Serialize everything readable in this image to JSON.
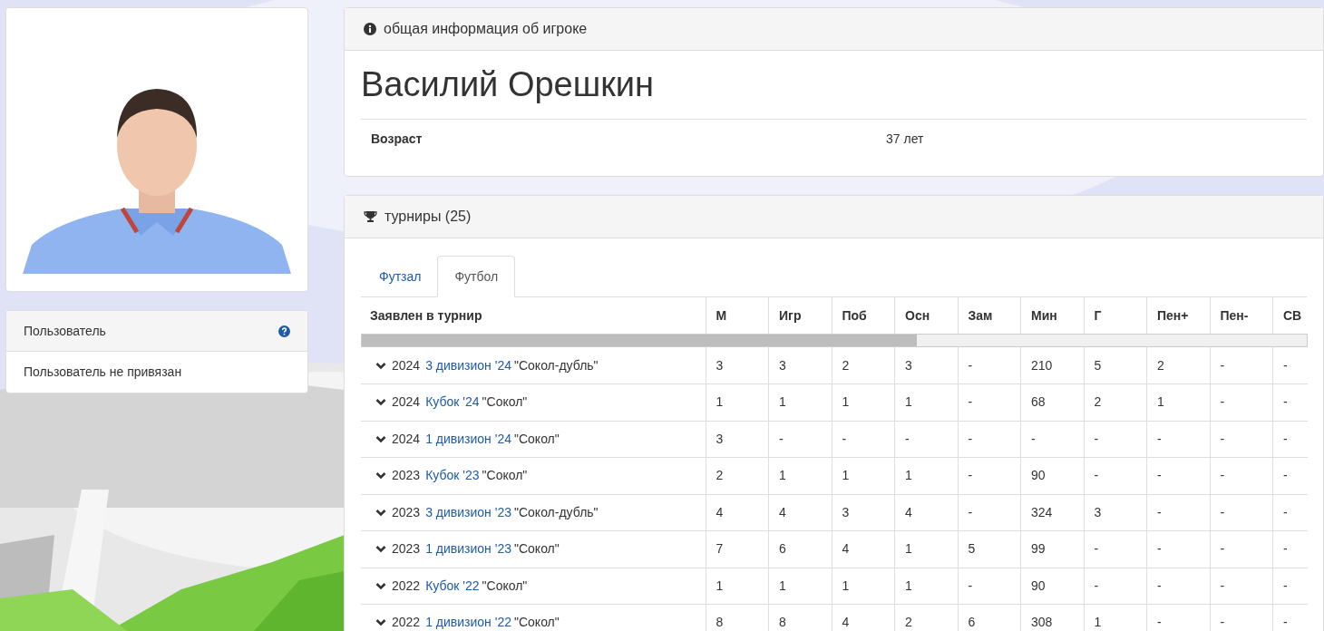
{
  "sidebar": {
    "user_list": [
      {
        "label": "Пользователь",
        "help": true
      },
      {
        "label": "Пользователь не привязан",
        "help": false
      }
    ]
  },
  "info_panel": {
    "title": "общая информация об игроке",
    "name": "Василий Орешкин",
    "fields": [
      {
        "label": "Возраст",
        "value": "37 лет"
      }
    ]
  },
  "tournaments_panel": {
    "title": "турниры (25)",
    "tabs": [
      {
        "label": "Футзал",
        "selected": false
      },
      {
        "label": "Футбол",
        "selected": true
      }
    ],
    "table": {
      "columns": [
        "Заявлен в турнир",
        "М",
        "Игр",
        "Поб",
        "Осн",
        "Зам",
        "Мин",
        "Г",
        "Пен+",
        "Пен-",
        "СВ"
      ],
      "rows": [
        {
          "year": "2024",
          "tournament": "3 дивизион '24",
          "team": "\"Сокол-дубль\"",
          "stats": [
            "3",
            "3",
            "2",
            "3",
            "-",
            "210",
            "5",
            "2",
            "-",
            "-"
          ]
        },
        {
          "year": "2024",
          "tournament": "Кубок '24",
          "team": "\"Сокол\"",
          "stats": [
            "1",
            "1",
            "1",
            "1",
            "-",
            "68",
            "2",
            "1",
            "-",
            "-"
          ]
        },
        {
          "year": "2024",
          "tournament": "1 дивизион '24",
          "team": "\"Сокол\"",
          "stats": [
            "3",
            "-",
            "-",
            "-",
            "-",
            "-",
            "-",
            "-",
            "-",
            "-"
          ]
        },
        {
          "year": "2023",
          "tournament": "Кубок '23",
          "team": "\"Сокол\"",
          "stats": [
            "2",
            "1",
            "1",
            "1",
            "-",
            "90",
            "-",
            "-",
            "-",
            "-"
          ]
        },
        {
          "year": "2023",
          "tournament": "3 дивизион '23",
          "team": "\"Сокол-дубль\"",
          "stats": [
            "4",
            "4",
            "3",
            "4",
            "-",
            "324",
            "3",
            "-",
            "-",
            "-"
          ]
        },
        {
          "year": "2023",
          "tournament": "1 дивизион '23",
          "team": "\"Сокол\"",
          "stats": [
            "7",
            "6",
            "4",
            "1",
            "5",
            "99",
            "-",
            "-",
            "-",
            "-"
          ]
        },
        {
          "year": "2022",
          "tournament": "Кубок '22",
          "team": "\"Сокол\"",
          "stats": [
            "1",
            "1",
            "1",
            "1",
            "-",
            "90",
            "-",
            "-",
            "-",
            "-"
          ]
        },
        {
          "year": "2022",
          "tournament": "1 дивизион '22",
          "team": "\"Сокол\"",
          "stats": [
            "8",
            "8",
            "4",
            "2",
            "6",
            "308",
            "1",
            "-",
            "-",
            "-"
          ]
        }
      ]
    }
  }
}
